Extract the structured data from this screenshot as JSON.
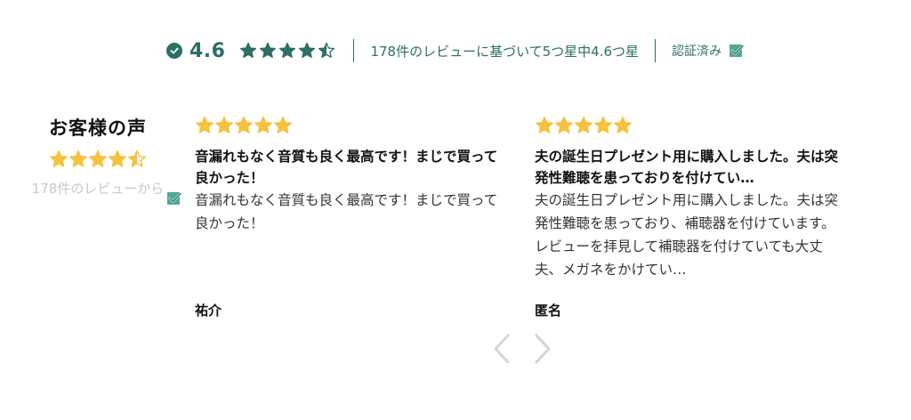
{
  "summary": {
    "average": "4.6",
    "text": "178件のレビューに基づいて5つ星中4.6つ星",
    "verified_label": "認証済み",
    "rating_value": 4.6,
    "star_color": "#2b6f65"
  },
  "aside": {
    "title": "お客様の声",
    "count_text": "178件のレビューから",
    "rating_value": 4.6,
    "star_color": "#f6c23e"
  },
  "reviews": [
    {
      "rating": 5,
      "title": "音漏れもなく音質も良く最高です！まじで買って良かった！",
      "body": "音漏れもなく音質も良く最高です！まじで買って良かった！",
      "author": "祐介"
    },
    {
      "rating": 5,
      "title": "夫の誕生日プレゼント用に購入しました。夫は突発性難聴を患っておりを付けてい…",
      "body": "夫の誕生日プレゼント用に購入しました。夫は突発性難聴を患っており、補聴器を付けています。レビューを拝見して補聴器を付けていても大丈夫、メガネをかけてい…",
      "author": "匿名"
    }
  ],
  "nav": {
    "prev_icon": "chevron-left-icon",
    "next_icon": "chevron-right-icon"
  },
  "colors": {
    "accent": "#2b6f65",
    "star_yellow": "#f6c23e",
    "muted": "#c8c8c8",
    "verified_check": "#4fa896"
  }
}
